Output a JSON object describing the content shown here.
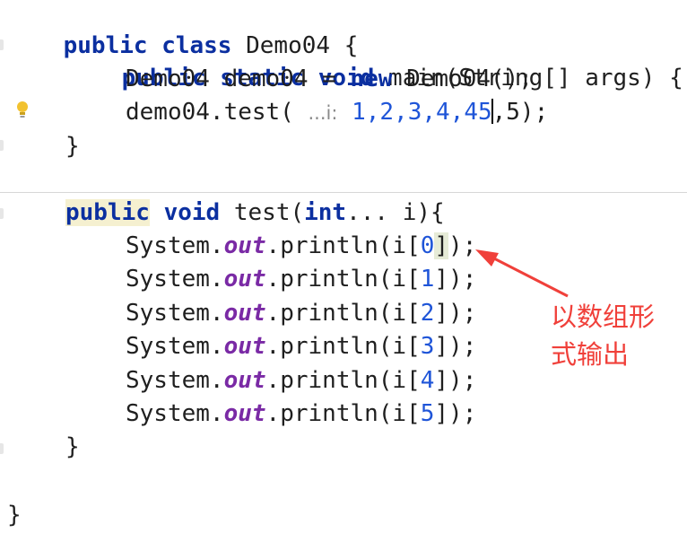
{
  "code": {
    "line1_text": "public class Demo04 {",
    "line2_text": "public static void main(String[] args) {",
    "line3_text": "Demo04 demo04 = new Demo04();",
    "line4": {
      "prefix": "demo04.test( ",
      "hint": "...i:",
      "args_before_caret": " 1,2,3,4,45",
      "args_after_caret": ",5);"
    },
    "line5_text": "}",
    "test_signature": {
      "kw_public": "public",
      "kw_void": "void",
      "name": " test(",
      "kw_int": "int",
      "rest": "... i){"
    },
    "println_lines": [
      {
        "prefix": "System.",
        "field": "out",
        "call": ".println(i[",
        "index": "0",
        "close": "]);"
      },
      {
        "prefix": "System.",
        "field": "out",
        "call": ".println(i[",
        "index": "1",
        "close": "]);"
      },
      {
        "prefix": "System.",
        "field": "out",
        "call": ".println(i[",
        "index": "2",
        "close": "]);"
      },
      {
        "prefix": "System.",
        "field": "out",
        "call": ".println(i[",
        "index": "3",
        "close": "]);"
      },
      {
        "prefix": "System.",
        "field": "out",
        "call": ".println(i[",
        "index": "4",
        "close": "]);"
      },
      {
        "prefix": "System.",
        "field": "out",
        "call": ".println(i[",
        "index": "5",
        "close": "]);"
      }
    ],
    "close_method": "}",
    "close_class": "}"
  },
  "annotation": {
    "text_line1": "以数组形",
    "text_line2": "式输出",
    "color": "#f0403a"
  },
  "icons": {
    "intention": "lightbulb-icon"
  }
}
